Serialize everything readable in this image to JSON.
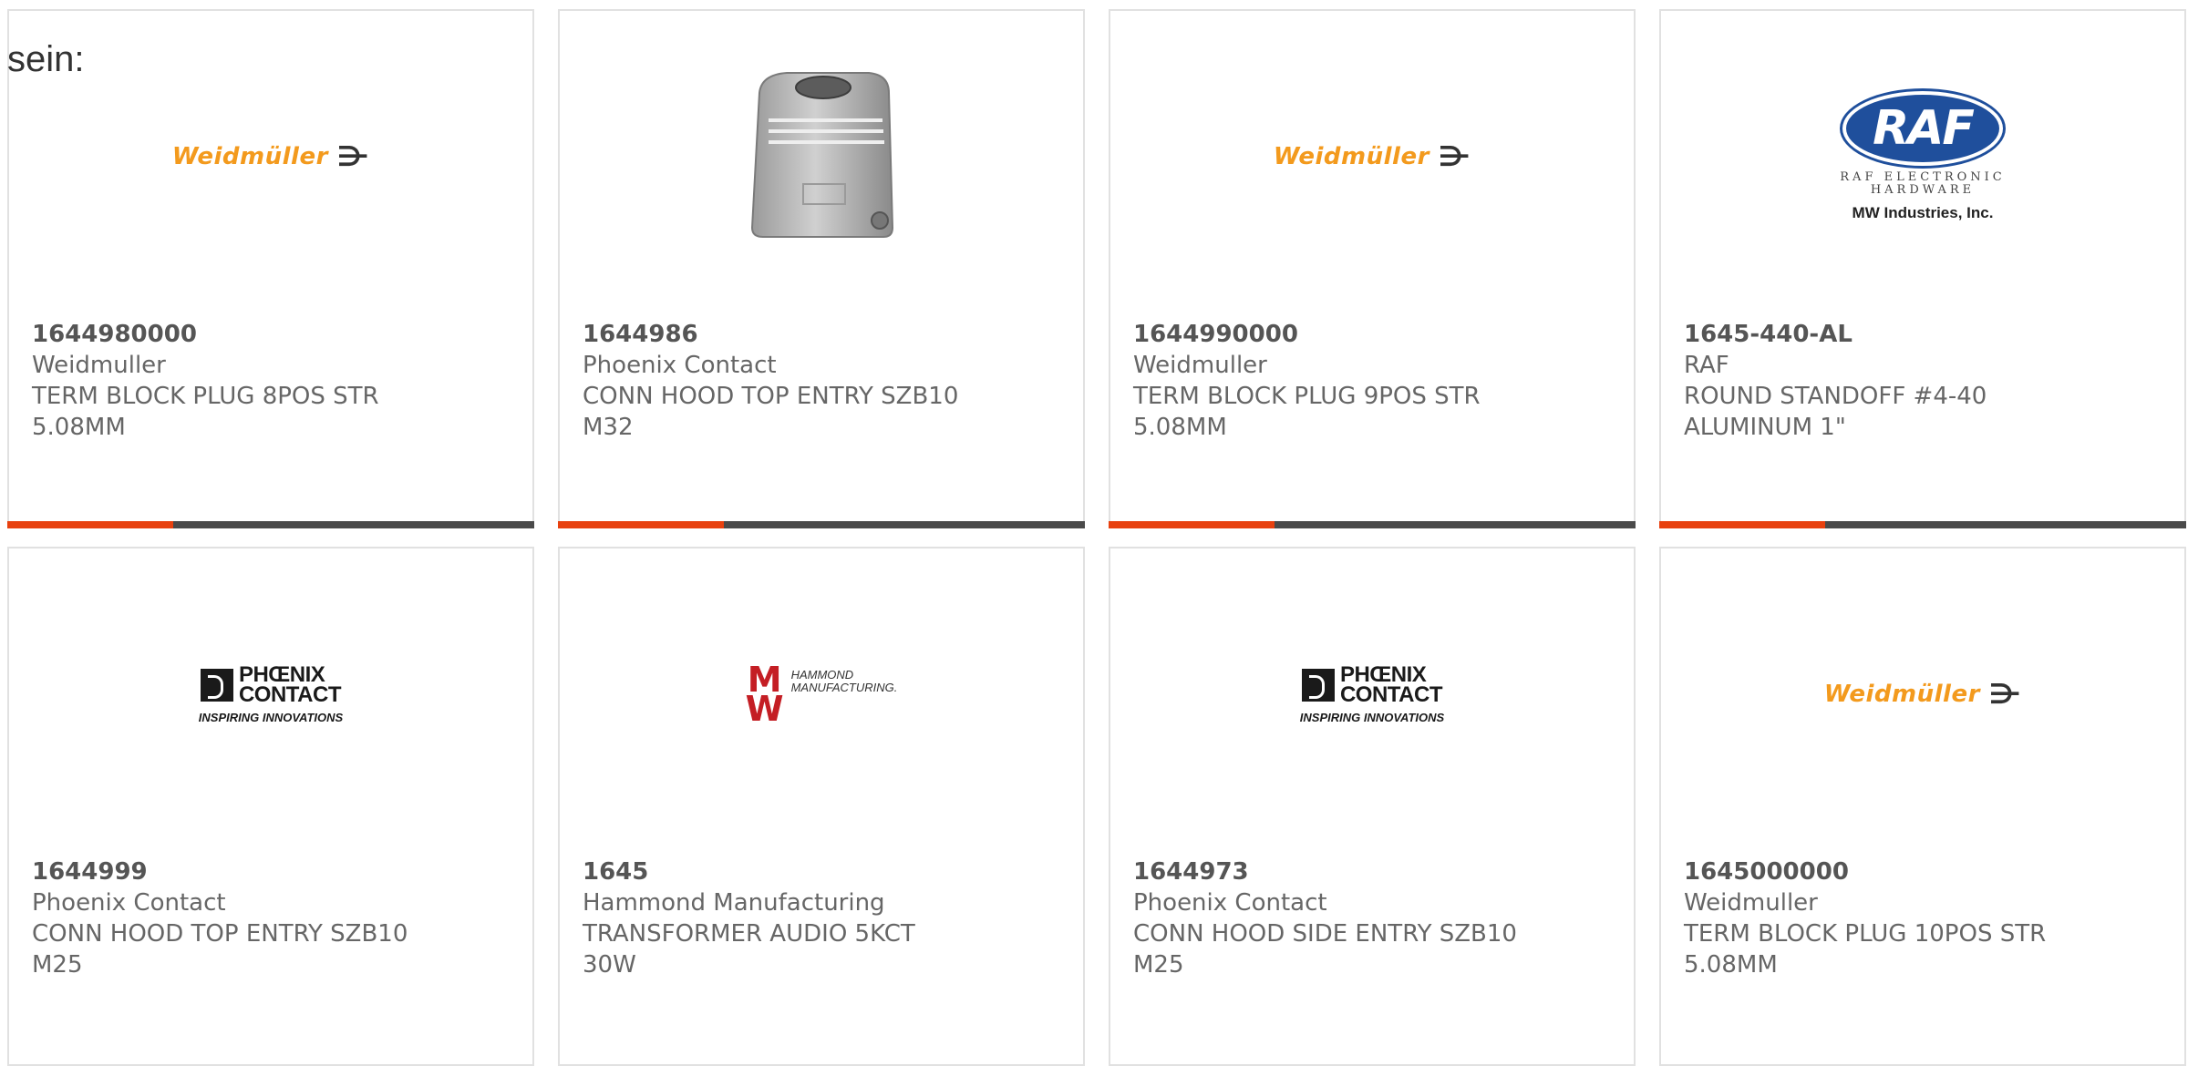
{
  "heading": "sein:",
  "colors": {
    "card_border": "#e1e1e1",
    "accent_bar": "#e8410f",
    "bottom_bar": "#4a4a4a",
    "text": "#666666"
  },
  "products": [
    {
      "part_number": "1644980000",
      "manufacturer": "Weidmuller",
      "description": "TERM BLOCK PLUG 8POS STR\n5.08MM",
      "image": "weidmuller-logo",
      "logo_text": "Weidmüller"
    },
    {
      "part_number": "1644986",
      "manufacturer": "Phoenix Contact",
      "description": "CONN HOOD TOP ENTRY SZB10\nM32",
      "image": "product-photo-hood"
    },
    {
      "part_number": "1644990000",
      "manufacturer": "Weidmuller",
      "description": "TERM BLOCK PLUG 9POS STR\n5.08MM",
      "image": "weidmuller-logo",
      "logo_text": "Weidmüller"
    },
    {
      "part_number": "1645-440-AL",
      "manufacturer": "RAF",
      "description": "ROUND STANDOFF #4-40\nALUMINUM 1\"",
      "image": "raf-logo",
      "logo_text": "RAF",
      "logo_sub": "RAF ELECTRONIC\nHARDWARE",
      "logo_company": "MW Industries, Inc."
    },
    {
      "part_number": "1644999",
      "manufacturer": "Phoenix Contact",
      "description": "CONN HOOD TOP ENTRY SZB10\nM25",
      "image": "phoenix-contact-logo",
      "logo_text": "PHŒNIX\nCONTACT",
      "logo_tag": "INSPIRING INNOVATIONS"
    },
    {
      "part_number": "1645",
      "manufacturer": "Hammond Manufacturing",
      "description": "TRANSFORMER AUDIO 5KCT\n30W",
      "image": "hammond-logo",
      "logo_text": "HAMMOND\nMANUFACTURING."
    },
    {
      "part_number": "1644973",
      "manufacturer": "Phoenix Contact",
      "description": "CONN HOOD SIDE ENTRY SZB10\nM25",
      "image": "phoenix-contact-logo",
      "logo_text": "PHŒNIX\nCONTACT",
      "logo_tag": "INSPIRING INNOVATIONS"
    },
    {
      "part_number": "1645000000",
      "manufacturer": "Weidmuller",
      "description": "TERM BLOCK PLUG 10POS STR\n5.08MM",
      "image": "weidmuller-logo",
      "logo_text": "Weidmüller"
    }
  ]
}
